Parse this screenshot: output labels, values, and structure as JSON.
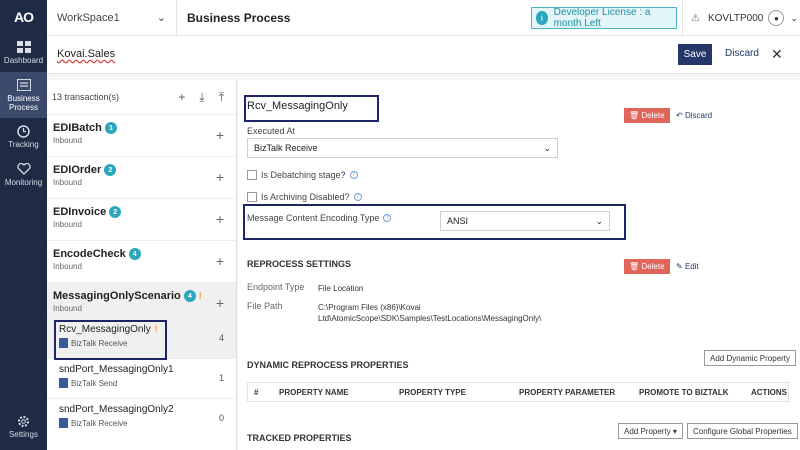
{
  "nav": {
    "logo": "AO",
    "items": [
      {
        "label": "Dashboard"
      },
      {
        "label": "Business Process"
      },
      {
        "label": "Tracking"
      },
      {
        "label": "Monitoring"
      }
    ],
    "settings": "Settings"
  },
  "topbar": {
    "workspace": "WorkSpace1",
    "title": "Business Process",
    "license": "Developer License : a month Left",
    "user": "KOVLTP000"
  },
  "subbar": {
    "process_name": "Kovai.Sales",
    "save": "Save",
    "discard": "Discard"
  },
  "list": {
    "count": "13 transaction(s)",
    "transactions": [
      {
        "name": "EDIBatch",
        "badge": "1",
        "sub": "Inbound"
      },
      {
        "name": "EDIOrder",
        "badge": "2",
        "sub": "Inbound"
      },
      {
        "name": "EDInvoice",
        "badge": "2",
        "sub": "Inbound"
      },
      {
        "name": "EncodeCheck",
        "badge": "4",
        "sub": "Inbound"
      },
      {
        "name": "MessagingOnlyScenario",
        "badge": "4",
        "sub": "Inbound"
      }
    ],
    "stages": [
      {
        "name": "Rcv_MessagingOnly",
        "type": "BizTalk Receive",
        "count": "4"
      },
      {
        "name": "sndPort_MessagingOnly1",
        "type": "BizTalk Send",
        "count": "1"
      },
      {
        "name": "sndPort_MessagingOnly2",
        "type": "BizTalk Receive",
        "count": "0"
      }
    ]
  },
  "detail": {
    "stage_name": "Rcv_MessagingOnly",
    "delete": "Delete",
    "discard": "Discard",
    "executed_at_label": "Executed At",
    "executed_at": "BizTalk Receive",
    "debatching": "Is Debatching stage?",
    "archiving": "Is Archiving Disabled?",
    "encoding_label": "Message Content Encoding Type",
    "encoding": "ANSI",
    "reprocess_title": "REPROCESS SETTINGS",
    "edit": "Edit",
    "endpoint_label": "Endpoint Type",
    "endpoint_value": "File Location",
    "filepath_label": "File Path",
    "filepath_value": "C:\\Program Files (x86)\\Kovai Ltd\\AtomicScope\\SDK\\Samples\\TestLocations\\MessagingOnly\\",
    "dynamic_title": "DYNAMIC REPROCESS PROPERTIES",
    "add_dynamic": "Add Dynamic Property",
    "columns": [
      "#",
      "PROPERTY NAME",
      "PROPERTY TYPE",
      "PROPERTY PARAMETER",
      "PROMOTE TO BIZTALK",
      "ACTIONS"
    ],
    "tracked_title": "TRACKED PROPERTIES",
    "add_property": "Add Property",
    "configure_global": "Configure Global Properties"
  }
}
